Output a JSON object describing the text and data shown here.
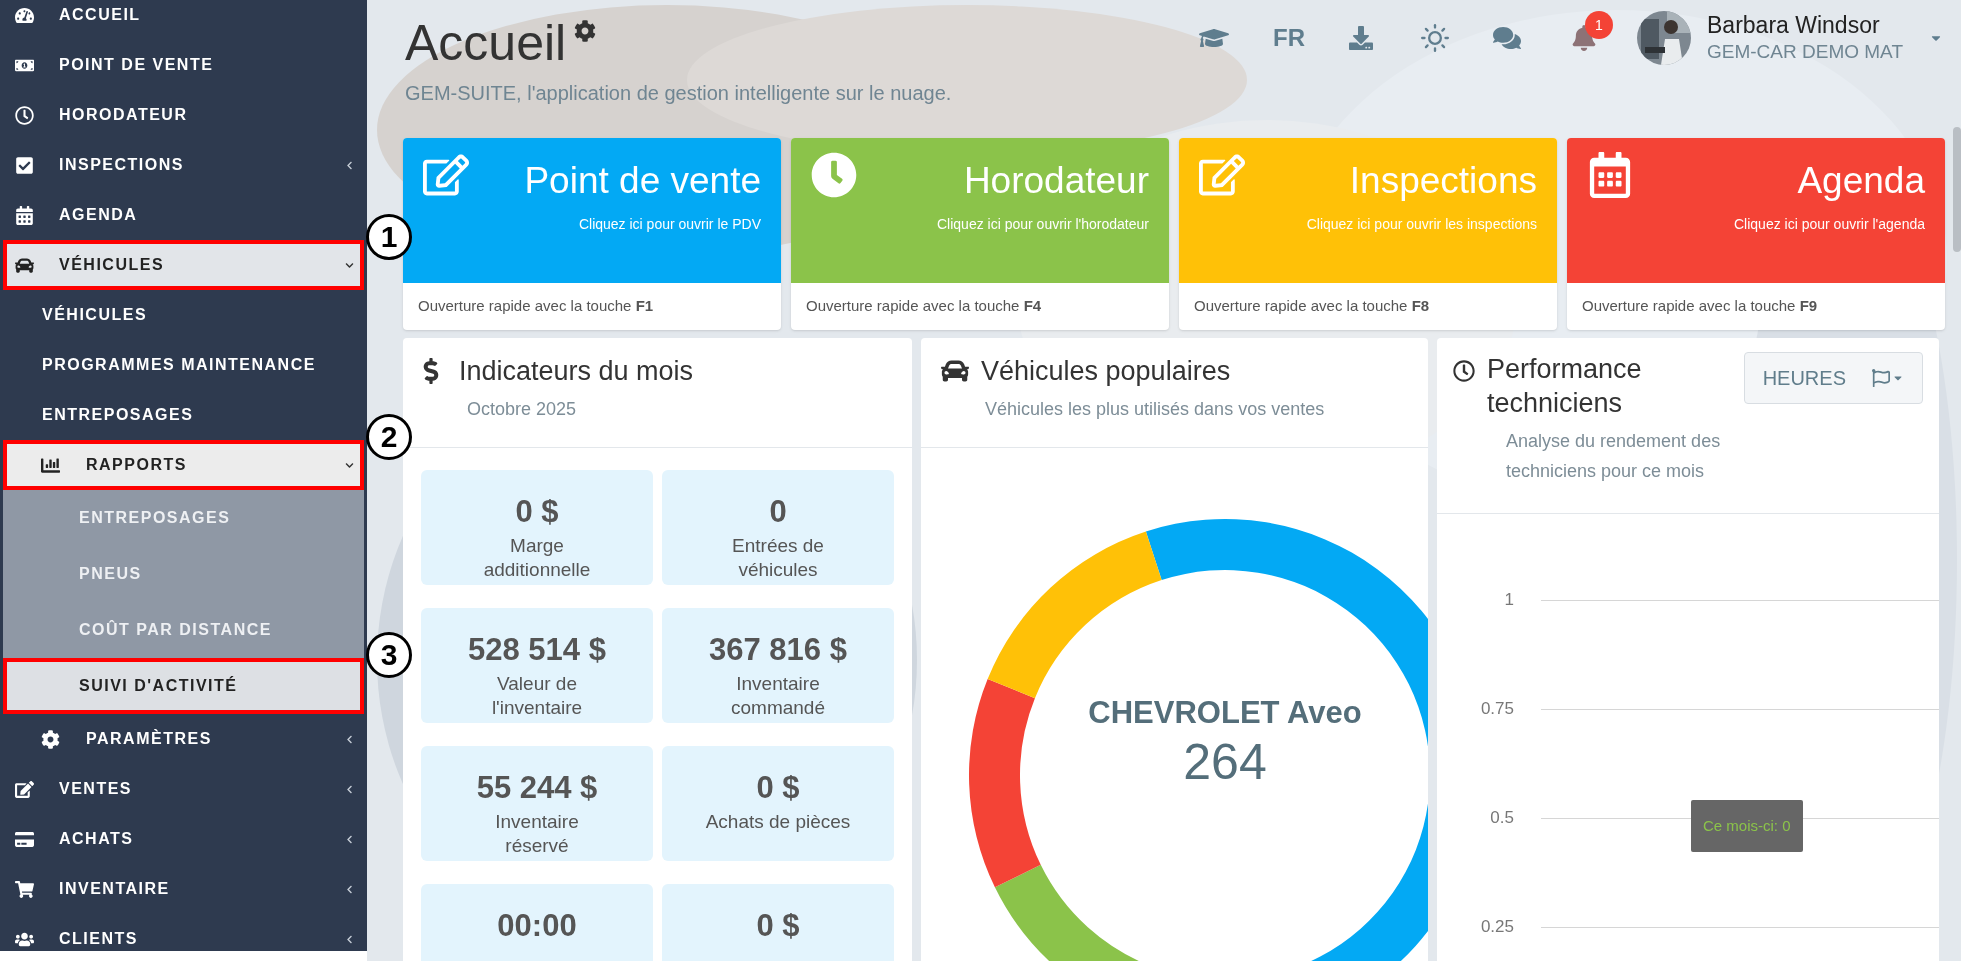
{
  "sidebar": {
    "items": [
      {
        "label": "ACCUEIL",
        "selected": false
      },
      {
        "label": "POINT DE VENTE",
        "selected": false
      },
      {
        "label": "HORODATEUR",
        "selected": false
      },
      {
        "label": "INSPECTIONS",
        "selected": false,
        "expanded": false
      },
      {
        "label": "AGENDA",
        "selected": false
      },
      {
        "label": "VÉHICULES",
        "selected": true,
        "expanded": true,
        "callout": "1",
        "children": [
          {
            "label": "VÉHICULES",
            "selected": false
          },
          {
            "label": "PROGRAMMES MAINTENANCE",
            "selected": false
          },
          {
            "label": "ENTREPOSAGES",
            "selected": false
          },
          {
            "label": "RAPPORTS",
            "selected": true,
            "expanded": true,
            "callout": "2",
            "children": [
              {
                "label": "ENTREPOSAGES",
                "selected": false
              },
              {
                "label": "PNEUS",
                "selected": false
              },
              {
                "label": "COÛT PAR DISTANCE",
                "selected": false
              },
              {
                "label": "SUIVI D'ACTIVITÉ",
                "selected": true,
                "callout": "3"
              }
            ]
          },
          {
            "label": "PARAMÈTRES",
            "selected": false,
            "expanded": false
          }
        ]
      },
      {
        "label": "VENTES",
        "selected": false,
        "expanded": false
      },
      {
        "label": "ACHATS",
        "selected": false,
        "expanded": false
      },
      {
        "label": "INVENTAIRE",
        "selected": false,
        "expanded": false
      },
      {
        "label": "CLIENTS",
        "selected": false,
        "expanded": false
      }
    ]
  },
  "header": {
    "title": "Accueil",
    "subtitle": "GEM-SUITE, l'application de gestion intelligente sur le nuage.",
    "language": "FR",
    "notification_count": "1",
    "user": {
      "name": "Barbara Windsor",
      "company": "GEM-CAR DEMO MAT"
    }
  },
  "tiles": [
    {
      "title": "Point de vente",
      "link": "Cliquez ici pour ouvrir le PDV",
      "footer": "Ouverture rapide avec la touche **F1**",
      "color": "#03a9f4"
    },
    {
      "title": "Horodateur",
      "link": "Cliquez ici pour ouvrir l'horodateur",
      "footer": "Ouverture rapide avec la touche **F4**",
      "color": "#8bc34a"
    },
    {
      "title": "Inspections",
      "link": "Cliquez ici pour ouvrir les inspections",
      "footer": "Ouverture rapide avec la touche **F8**",
      "color": "#ffc107"
    },
    {
      "title": "Agenda",
      "link": "Cliquez ici pour ouvrir l'agenda",
      "footer": "Ouverture rapide avec la touche **F9**",
      "color": "#f44336"
    }
  ],
  "indicators": {
    "title": "Indicateurs du mois",
    "subtitle": "Octobre 2025",
    "stats": [
      {
        "value": "0 $",
        "label": "Marge additionnelle"
      },
      {
        "value": "0",
        "label": "Entrées de véhicules"
      },
      {
        "value": "528 514 $",
        "label": "Valeur de l'inventaire"
      },
      {
        "value": "367 816 $",
        "label": "Inventaire commandé"
      },
      {
        "value": "55 244 $",
        "label": "Inventaire réservé"
      },
      {
        "value": "0 $",
        "label": "Achats de pièces"
      },
      {
        "value": "00:00"
      },
      {
        "value": "0 $"
      }
    ]
  },
  "popular_vehicles": {
    "title": "Véhicules populaires",
    "subtitle": "Véhicules les plus utilisés dans vos ventes",
    "center_label": "CHEVROLET Aveo",
    "center_value": "264"
  },
  "performance": {
    "title": "Performance techniciens",
    "button": "HEURES",
    "subtitle": "Analyse du rendement des techniciens pour ce mois",
    "tooltip": "Ce mois-ci: 0",
    "axis_labels": [
      "1",
      "0.75",
      "0.5",
      "0.25"
    ]
  }
}
